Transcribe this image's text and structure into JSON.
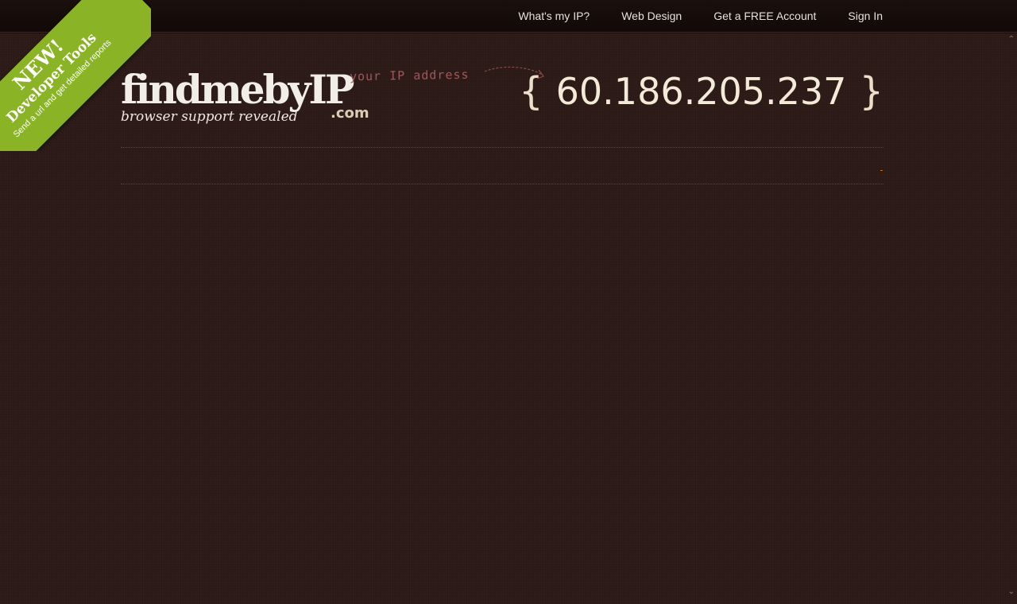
{
  "nav": {
    "items": [
      {
        "label": "What's my IP?"
      },
      {
        "label": "Web Design"
      },
      {
        "label": "Get a FREE Account"
      },
      {
        "label": "Sign In"
      }
    ]
  },
  "ribbon": {
    "line1": "NEW!",
    "line2": "Developer Tools",
    "line3": "Send a url and get detailed reports",
    "color": "#8ab325"
  },
  "logo": {
    "main": "findmebyIP",
    "tld": ".com",
    "tagline": "browser support revealed"
  },
  "annotation": {
    "text": "your IP address"
  },
  "ip": {
    "open_brace": "{",
    "value": "60.186.205.237",
    "close_brace": "}"
  },
  "colors": {
    "background": "#2c1a17",
    "topbar": "#120a08",
    "ip_text": "#f3ead7",
    "annotation": "#a0585a"
  },
  "icons": {
    "scroll_up": "chevron-up-icon",
    "scroll_down": "chevron-down-icon"
  }
}
